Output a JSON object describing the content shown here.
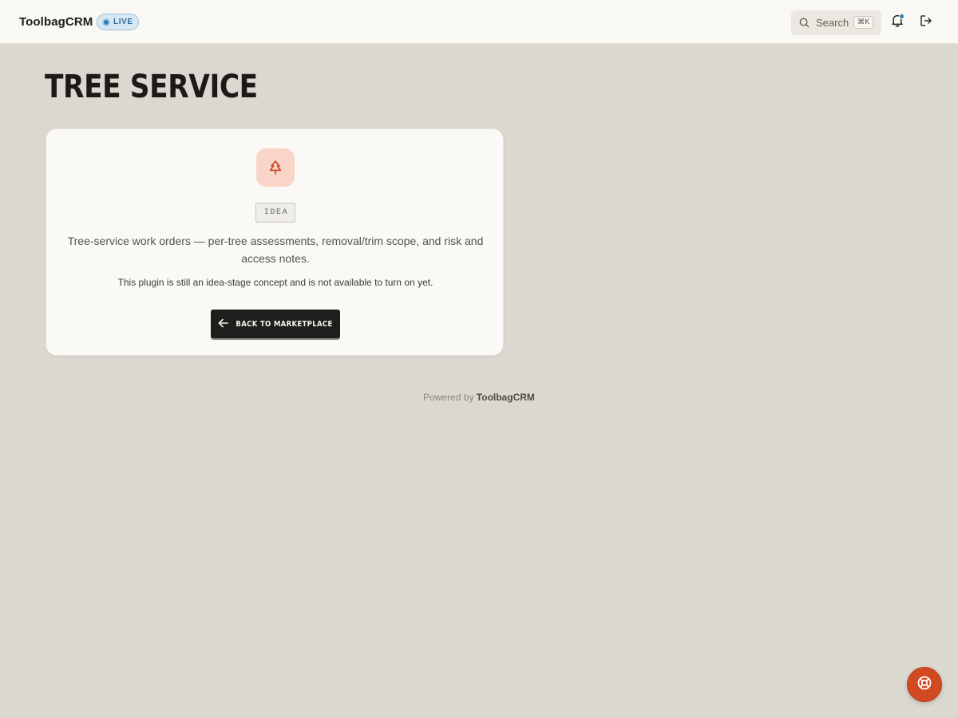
{
  "header": {
    "brand": "ToolbagCRM",
    "env_badge": "LIVE",
    "search_label": "Search",
    "search_shortcut": "⌘K",
    "icons": {
      "search": "search-icon",
      "notifications": "bell-icon",
      "logout": "logout-icon"
    }
  },
  "page": {
    "title": "TREE SERVICE"
  },
  "card": {
    "icon": "tree-icon",
    "stage_badge": "IDEA",
    "description": "Tree-service work orders — per-tree assessments, removal/trim scope, and risk and access notes.",
    "note": "This plugin is still an idea-stage concept and is not available to turn on yet.",
    "back_button": "BACK TO MARKETPLACE"
  },
  "footer": {
    "powered_by": "Powered by",
    "brand": "ToolbagCRM"
  },
  "help": {
    "icon": "lifebuoy-icon"
  },
  "colors": {
    "accent": "#d24a22",
    "live_blue": "#2e7cb3",
    "background": "#dbd8d0",
    "surface": "#faf9f5",
    "dark_button": "#1f1e1c"
  }
}
